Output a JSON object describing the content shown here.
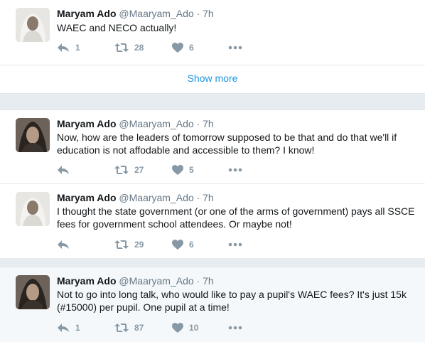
{
  "tweets": [
    {
      "author": "Maryam Ado",
      "handle": "@Maaryam_Ado",
      "dot": "·",
      "time": "7h",
      "text": "WAEC and NECO actually!",
      "replies": "1",
      "retweets": "28",
      "likes": "6"
    },
    {
      "author": "Maryam Ado",
      "handle": "@Maaryam_Ado",
      "dot": "·",
      "time": "7h",
      "text": "Now,  how are the leaders of tomorrow supposed to be that and do that we'll if education is not affodable and accessible to them? I know!",
      "replies": "",
      "retweets": "27",
      "likes": "5"
    },
    {
      "author": "Maryam Ado",
      "handle": "@Maaryam_Ado",
      "dot": "·",
      "time": "7h",
      "text": "I thought the state government (or one of the arms of government) pays all SSCE fees for government school attendees. Or maybe not!",
      "replies": "",
      "retweets": "29",
      "likes": "6"
    },
    {
      "author": "Maryam Ado",
      "handle": "@Maaryam_Ado",
      "dot": "·",
      "time": "7h",
      "text": "Not to go into long talk, who would like to pay a pupil's WAEC fees? It's just 15k (#15000) per pupil. One pupil at a time!",
      "replies": "1",
      "retweets": "87",
      "likes": "10"
    }
  ],
  "show_more": "Show more",
  "icons": {
    "reply": "reply-icon",
    "retweet": "retweet-icon",
    "like": "heart-icon",
    "more": "more-dots-icon"
  },
  "colors": {
    "link": "#1b95e0",
    "muted": "#657786",
    "icon": "#8899a6",
    "background": "#e6ecf0"
  }
}
